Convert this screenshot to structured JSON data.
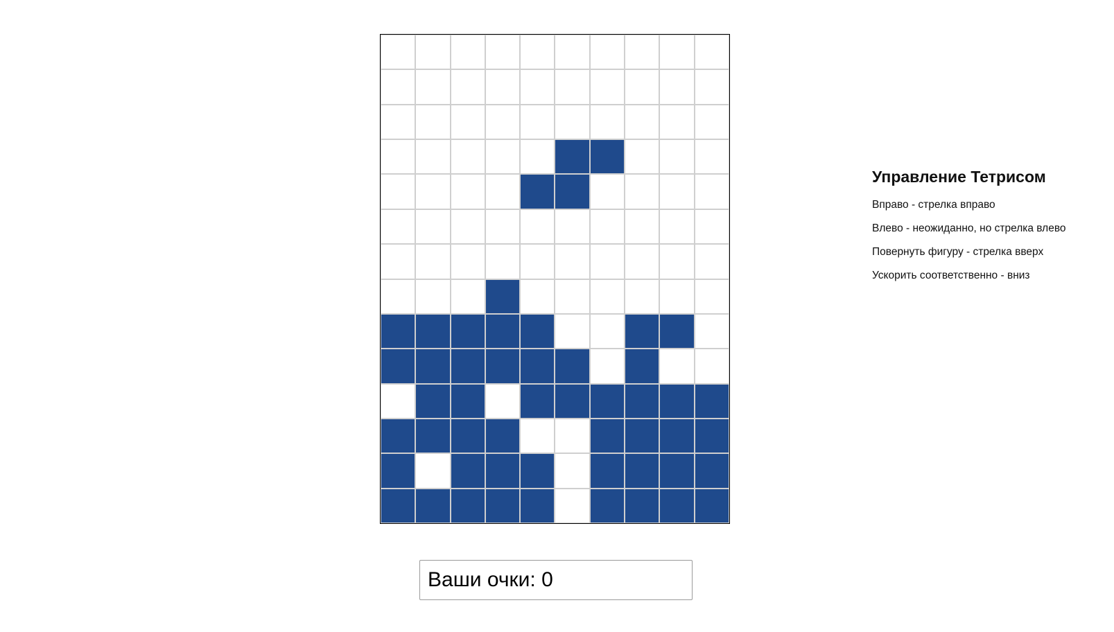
{
  "game": {
    "colors": {
      "block": "#1f4a8c",
      "empty": "#ffffff",
      "grid_line": "#cfcfcf"
    },
    "board": {
      "columns": 10,
      "rows": 14,
      "grid": [
        [
          0,
          0,
          0,
          0,
          0,
          0,
          0,
          0,
          0,
          0
        ],
        [
          0,
          0,
          0,
          0,
          0,
          0,
          0,
          0,
          0,
          0
        ],
        [
          0,
          0,
          0,
          0,
          0,
          0,
          0,
          0,
          0,
          0
        ],
        [
          0,
          0,
          0,
          0,
          0,
          1,
          1,
          0,
          0,
          0
        ],
        [
          0,
          0,
          0,
          0,
          1,
          1,
          0,
          0,
          0,
          0
        ],
        [
          0,
          0,
          0,
          0,
          0,
          0,
          0,
          0,
          0,
          0
        ],
        [
          0,
          0,
          0,
          0,
          0,
          0,
          0,
          0,
          0,
          0
        ],
        [
          0,
          0,
          0,
          1,
          0,
          0,
          0,
          0,
          0,
          0
        ],
        [
          1,
          1,
          1,
          1,
          1,
          0,
          0,
          1,
          1,
          0
        ],
        [
          1,
          1,
          1,
          1,
          1,
          1,
          0,
          1,
          0,
          0
        ],
        [
          0,
          1,
          1,
          0,
          1,
          1,
          1,
          1,
          1,
          1
        ],
        [
          1,
          1,
          1,
          1,
          0,
          0,
          1,
          1,
          1,
          1
        ],
        [
          1,
          0,
          1,
          1,
          1,
          0,
          1,
          1,
          1,
          1
        ],
        [
          1,
          1,
          1,
          1,
          1,
          0,
          1,
          1,
          1,
          1
        ]
      ]
    },
    "score": {
      "text": "Ваши очки: 0",
      "value": 0
    }
  },
  "controls": {
    "title": "Управление Тетрисом",
    "items": [
      "Вправо - стрелка вправо",
      "Влево - неожиданно, но стрелка влево",
      "Повернуть фигуру - стрелка вверх",
      "Ускорить соответственно - вниз"
    ]
  }
}
